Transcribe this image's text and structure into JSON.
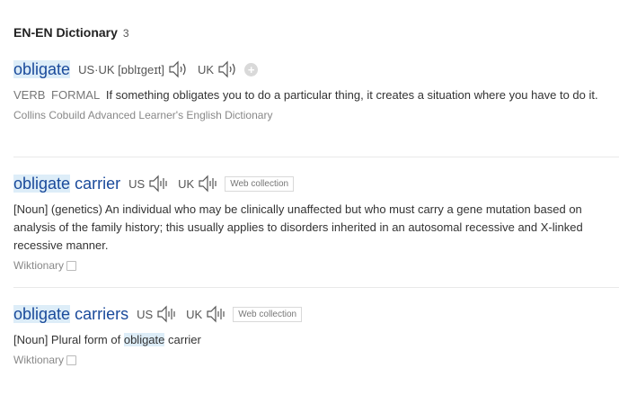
{
  "header": {
    "title": "EN-EN Dictionary",
    "count": "3"
  },
  "entries": [
    {
      "word": "obligate",
      "us_uk_label": "US·UK",
      "phonetic": "[ɒblɪgeɪt]",
      "uk_label": "UK",
      "pos1": "VERB",
      "pos2": "FORMAL",
      "definition": "If something obligates you to do a particular thing, it creates a situation where you have to do it.",
      "source": "Collins Cobuild Advanced Learner's English Dictionary"
    },
    {
      "word_part1": "obligate",
      "word_part2": "carrier",
      "us_label": "US",
      "uk_label": "UK",
      "tag": "Web collection",
      "definition": "[Noun] (genetics) An individual who may be clinically unaffected but who must carry a gene mutation based on analysis of the family history; this usually applies to disorders inherited in an autosomal recessive and X-linked recessive manner.",
      "source": "Wiktionary"
    },
    {
      "word_part1": "obligate",
      "word_part2": "carriers",
      "us_label": "US",
      "uk_label": "UK",
      "tag": "Web collection",
      "def_prefix": "[Noun] Plural form of",
      "def_link": "obligate",
      "def_suffix": "carrier",
      "source": "Wiktionary"
    }
  ]
}
